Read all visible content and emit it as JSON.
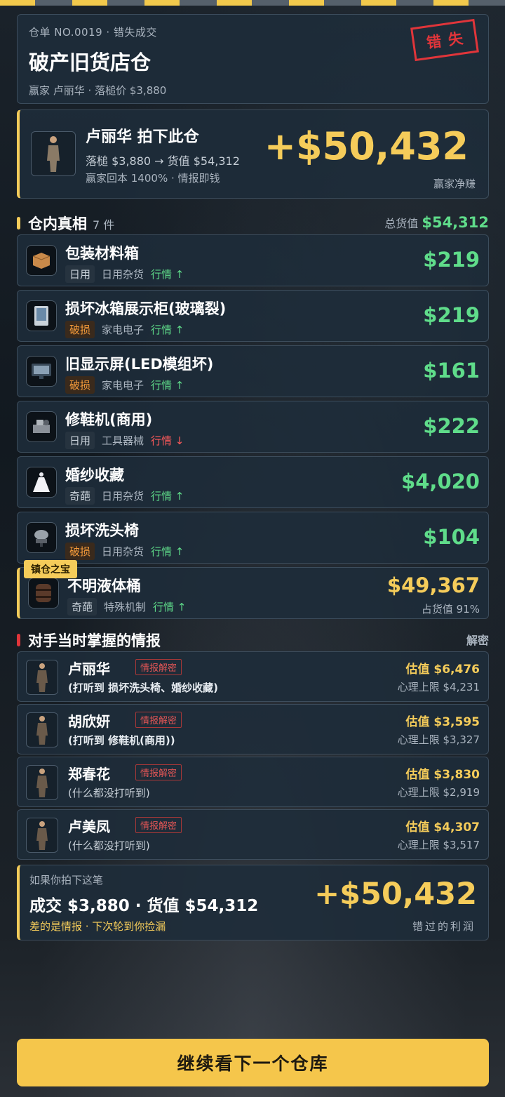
{
  "header": {
    "meta": "仓单 NO.0019 · 错失成交",
    "title": "破产旧货店仓",
    "sub": "赢家 卢丽华 · 落槌价 $3,880",
    "stamp": "错失"
  },
  "winner": {
    "name": "卢丽华 拍下此仓",
    "line2": "落槌 $3,880 → 货值 $54,312",
    "line3": "赢家回本 1400% · 情报即钱",
    "profit": "+$50,432",
    "caption": "赢家净赚"
  },
  "items_section": {
    "title": "仓内真相",
    "count": "7 件",
    "total_label": "总货值",
    "total_value": "$54,312"
  },
  "items": [
    {
      "name": "包装材料箱",
      "tag": "日用",
      "category": "日用杂货",
      "trend": "行情 ↑",
      "trend_dir": "up",
      "price": "$219",
      "icon": "box-icon",
      "damaged": false
    },
    {
      "name": "损坏冰箱展示柜(玻璃裂)",
      "tag": "破损",
      "category": "家电电子",
      "trend": "行情 ↑",
      "trend_dir": "up",
      "price": "$219",
      "icon": "fridge-icon",
      "damaged": true
    },
    {
      "name": "旧显示屏(LED模组坏)",
      "tag": "破损",
      "category": "家电电子",
      "trend": "行情 ↑",
      "trend_dir": "up",
      "price": "$161",
      "icon": "monitor-icon",
      "damaged": true
    },
    {
      "name": "修鞋机(商用)",
      "tag": "日用",
      "category": "工具器械",
      "trend": "行情 ↓",
      "trend_dir": "down",
      "price": "$222",
      "icon": "machine-icon",
      "damaged": false
    },
    {
      "name": "婚纱收藏",
      "tag": "奇葩",
      "category": "日用杂货",
      "trend": "行情 ↑",
      "trend_dir": "up",
      "price": "$4,020",
      "icon": "dress-icon",
      "damaged": false
    },
    {
      "name": "损坏洗头椅",
      "tag": "破损",
      "category": "日用杂货",
      "trend": "行情 ↑",
      "trend_dir": "up",
      "price": "$104",
      "icon": "chair-icon",
      "damaged": true
    }
  ],
  "treasure": {
    "badge": "镇仓之宝",
    "name": "不明液体桶",
    "tag": "奇葩",
    "category": "特殊机制",
    "trend": "行情 ↑",
    "price": "$49,367",
    "share": "占货值 91%",
    "icon": "barrel-icon"
  },
  "intel_section": {
    "title": "对手当时掌握的情报",
    "action": "解密"
  },
  "rivals": [
    {
      "name": "卢丽华",
      "label": "情报解密",
      "heard": "(打听到 损坏洗头椅、婚纱收藏)",
      "estimate": "估值 $6,476",
      "limit": "心理上限 $4,231",
      "knows": true
    },
    {
      "name": "胡欣妍",
      "label": "情报解密",
      "heard": "(打听到 修鞋机(商用))",
      "estimate": "估值 $3,595",
      "limit": "心理上限 $3,327",
      "knows": true
    },
    {
      "name": "郑春花",
      "label": "情报解密",
      "heard": "(什么都没打听到)",
      "estimate": "估值 $3,830",
      "limit": "心理上限 $2,919",
      "knows": false
    },
    {
      "name": "卢美凤",
      "label": "情报解密",
      "heard": "(什么都没打听到)",
      "estimate": "估值 $4,307",
      "limit": "心理上限 $3,517",
      "knows": false
    }
  ],
  "summary": {
    "line1": "如果你拍下这笔",
    "line2": "成交 $3,880 · 货值 $54,312",
    "line3": "差的是情报 · 下次轮到你捡漏",
    "profit": "+$50,432",
    "caption": "错过的利润"
  },
  "cta": {
    "label": "继续看下一个仓库"
  }
}
